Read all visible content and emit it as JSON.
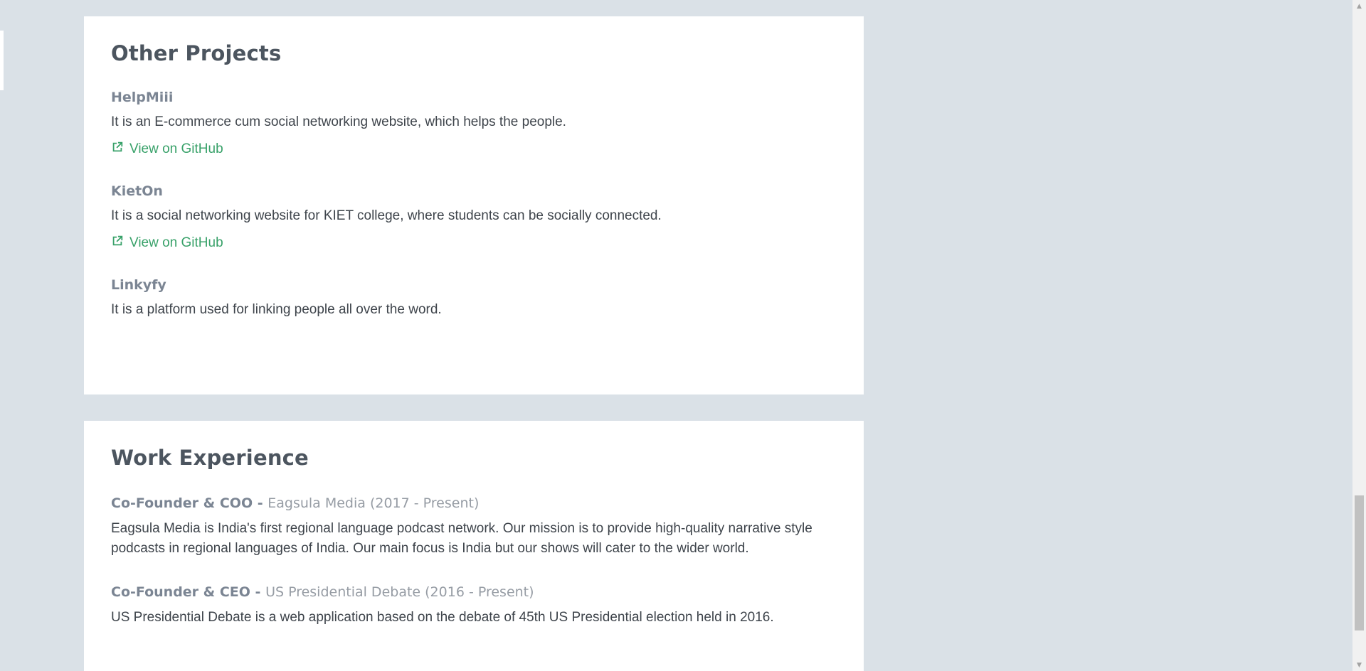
{
  "projects_section": {
    "title": "Other Projects",
    "items": [
      {
        "name": "HelpMiii",
        "description": "It is an E-commerce cum social networking website, which helps the people.",
        "link_label": "View on GitHub"
      },
      {
        "name": "KietOn",
        "description": "It is a social networking website for KIET college, where students can be socially connected.",
        "link_label": "View on GitHub"
      },
      {
        "name": "Linkyfy",
        "description": "It is a platform used for linking people all over the word."
      }
    ]
  },
  "work_section": {
    "title": "Work Experience",
    "jobs": [
      {
        "role": "Co-Founder & COO",
        "separator": " - ",
        "org": "Eagsula Media (2017 - Present)",
        "description": "Eagsula Media is India's first regional language podcast network. Our mission is to provide high-quality narrative style podcasts in regional languages of India. Our main focus is India but our shows will cater to the wider world."
      },
      {
        "role": "Co-Founder & CEO",
        "separator": " - ",
        "org": "US Presidential Debate (2016 - Present)",
        "description": "US Presidential Debate is a web application based on the debate of 45th US Presidential election held in 2016."
      }
    ]
  },
  "icons": {
    "external_link": "external-link-icon",
    "scroll_up": "scroll-up-arrow-icon",
    "scroll_down": "scroll-down-arrow-icon"
  },
  "colors": {
    "background": "#dae1e7",
    "card": "#ffffff",
    "heading": "#4c555f",
    "subheading": "#7b8593",
    "body_text": "#3e444b",
    "link": "#38a169"
  }
}
